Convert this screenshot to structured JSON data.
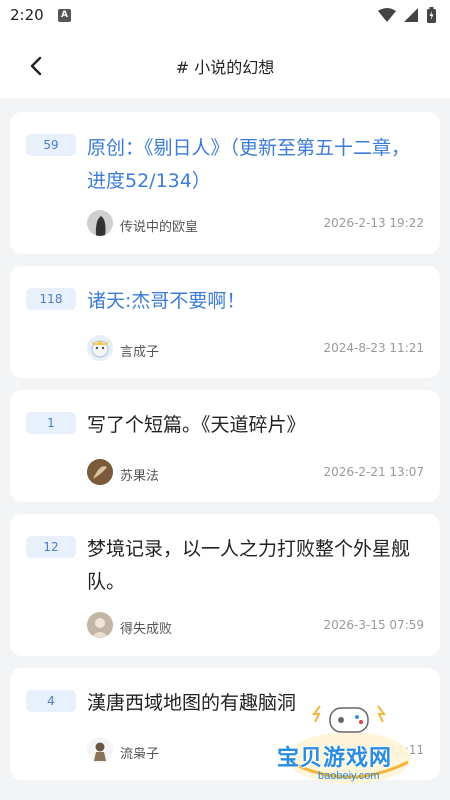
{
  "status_bar": {
    "time": "2:20",
    "notification": "A"
  },
  "header": {
    "title": "# 小说的幻想"
  },
  "posts": [
    {
      "count": "59",
      "title": "原创：《剔日人》（更新至第五十二章，进度52/134）",
      "highlighted": true,
      "author": "传说中的欧皇",
      "datetime": "2026-2-13 19:22"
    },
    {
      "count": "118",
      "title": "诸天:杰哥不要啊！",
      "highlighted": true,
      "author": "言成子",
      "datetime": "2024-8-23 11:21"
    },
    {
      "count": "1",
      "title": "写了个短篇。《天道碎片》",
      "highlighted": false,
      "author": "苏果法",
      "datetime": "2026-2-21 13:07"
    },
    {
      "count": "12",
      "title": "梦境记录，以一人之力打败整个外星舰队。",
      "highlighted": false,
      "author": "得失成败",
      "datetime": "2026-3-15 07:59"
    },
    {
      "count": "4",
      "title": "漢唐西域地图的有趣脑洞",
      "highlighted": false,
      "author": "流枭子",
      "datetime": "2025-1-21 11:11"
    }
  ],
  "watermark": {
    "name": "宝贝游戏网",
    "url": "baobeiy.com"
  },
  "colors": {
    "accent": "#3d7cd6",
    "badge_bg": "#e7f0fb",
    "page_bg": "#f3f4f6"
  }
}
